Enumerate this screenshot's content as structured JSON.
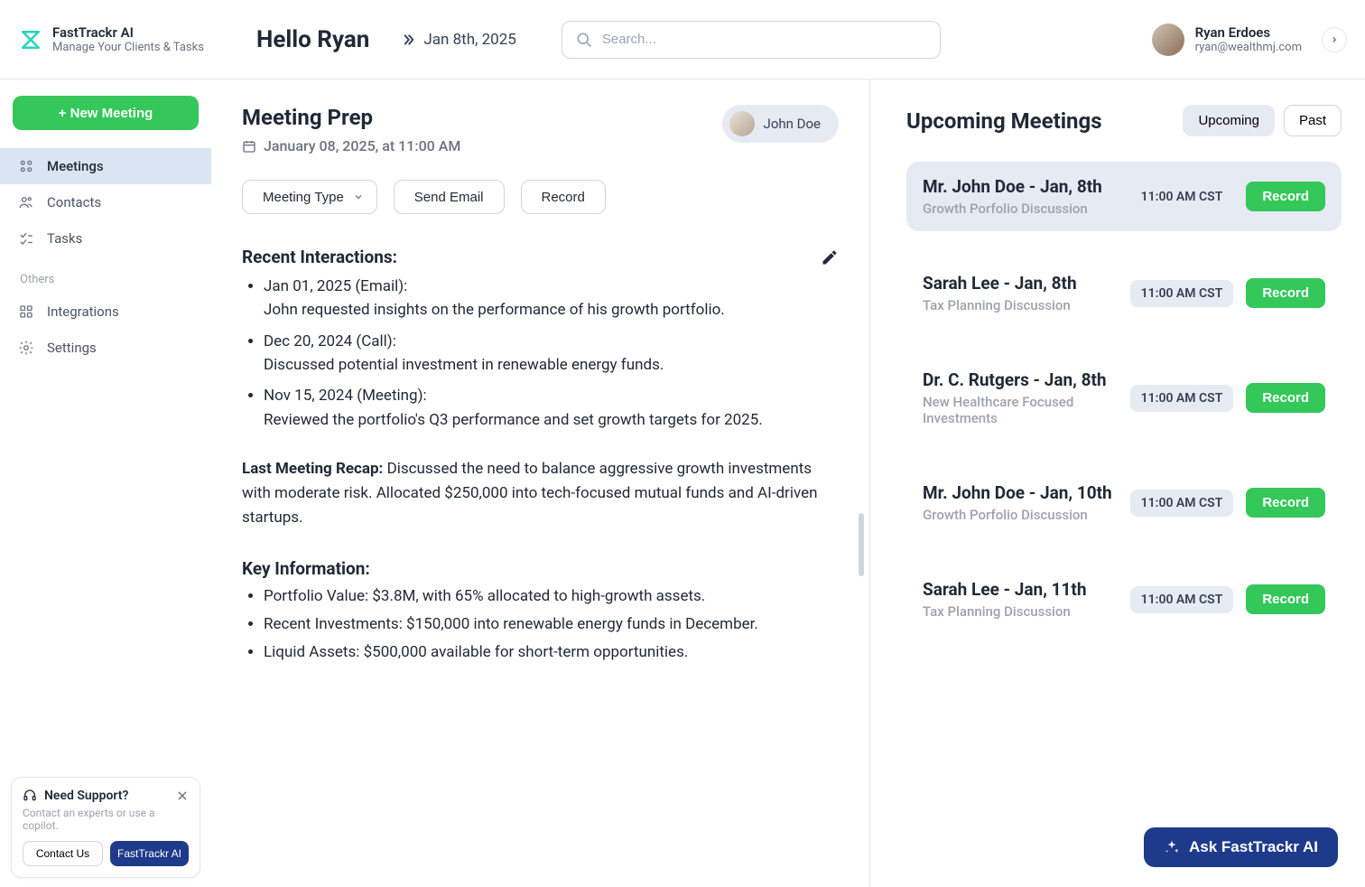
{
  "brand": {
    "name": "FastTrackr AI",
    "tagline": "Manage Your Clients & Tasks"
  },
  "header": {
    "greeting": "Hello Ryan",
    "date": "Jan 8th, 2025",
    "search_placeholder": "Search..."
  },
  "user": {
    "name": "Ryan Erdoes",
    "email": "ryan@wealthmj.com"
  },
  "sidebar": {
    "new_meeting": "+ New Meeting",
    "items": [
      {
        "label": "Meetings"
      },
      {
        "label": "Contacts"
      },
      {
        "label": "Tasks"
      }
    ],
    "others_label": "Others",
    "others": [
      {
        "label": "Integrations"
      },
      {
        "label": "Settings"
      }
    ]
  },
  "support": {
    "title": "Need Support?",
    "subtitle": "Contact an experts or use a copilot.",
    "contact": "Contact Us",
    "ai": "FastTrackr AI"
  },
  "prep": {
    "title": "Meeting Prep",
    "date": "January 08, 2025, at 11:00 AM",
    "attendee": "John Doe",
    "actions": {
      "type": "Meeting Type",
      "email": "Send Email",
      "record": "Record"
    },
    "recent_title": "Recent Interactions:",
    "interactions": [
      {
        "head": "Jan 01, 2025 (Email):",
        "body": "John requested insights on the performance of his growth portfolio."
      },
      {
        "head": "Dec 20, 2024 (Call):",
        "body": "Discussed potential investment in renewable energy funds."
      },
      {
        "head": "Nov 15, 2024 (Meeting):",
        "body": "Reviewed the portfolio's Q3 performance and set growth targets for 2025."
      }
    ],
    "recap_label": "Last Meeting Recap:",
    "recap_body": " Discussed the need to balance aggressive growth investments with moderate risk. Allocated $250,000 into tech-focused mutual funds and AI-driven startups.",
    "key_title": "Key Information:",
    "key_items": [
      "Portfolio Value: $3.8M, with 65% allocated to high-growth assets.",
      "Recent Investments: $150,000 into renewable energy funds in December.",
      "Liquid Assets: $500,000 available for short-term opportunities."
    ]
  },
  "upcoming": {
    "title": "Upcoming Meetings",
    "tabs": {
      "upcoming": "Upcoming",
      "past": "Past"
    },
    "record_label": "Record",
    "meetings": [
      {
        "title": "Mr. John Doe  - Jan, 8th",
        "sub": "Growth Porfolio Discussion",
        "time": "11:00 AM CST",
        "active": true
      },
      {
        "title": "Sarah Lee - Jan, 8th",
        "sub": "Tax Planning Discussion",
        "time": "11:00 AM CST",
        "active": false
      },
      {
        "title": "Dr. C. Rutgers - Jan, 8th",
        "sub": "New Healthcare Focused Investments",
        "time": "11:00 AM CST",
        "active": false
      },
      {
        "title": "Mr. John Doe - Jan, 10th",
        "sub": "Growth Porfolio Discussion",
        "time": "11:00 AM CST",
        "active": false
      },
      {
        "title": "Sarah Lee - Jan, 11th",
        "sub": "Tax Planning Discussion",
        "time": "11:00 AM CST",
        "active": false
      }
    ]
  },
  "ask_ai": "Ask FastTrackr AI"
}
